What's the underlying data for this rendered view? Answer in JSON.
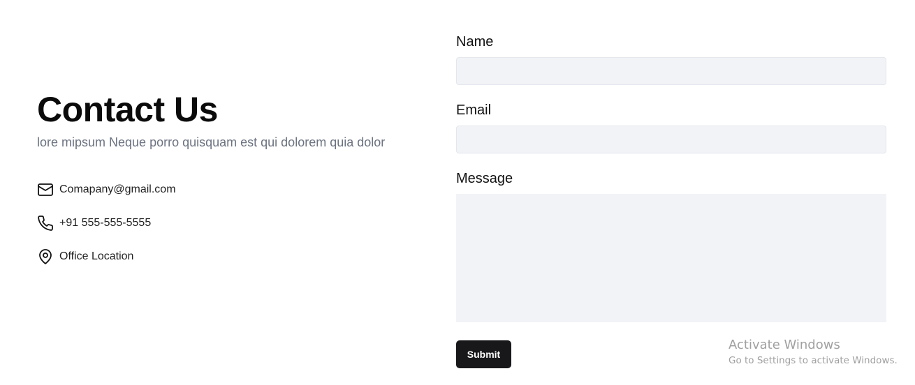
{
  "contact": {
    "title": "Contact Us",
    "subtitle": "lore mipsum Neque porro quisquam est qui dolorem quia dolor",
    "items": [
      {
        "icon": "mail-icon",
        "text": "Comapany@gmail.com"
      },
      {
        "icon": "phone-icon",
        "text": "+91 555-555-5555"
      },
      {
        "icon": "location-pin-icon",
        "text": "Office Location"
      }
    ]
  },
  "form": {
    "name_label": "Name",
    "name_value": "",
    "email_label": "Email",
    "email_value": "",
    "message_label": "Message",
    "message_value": "",
    "submit_label": "Submit"
  },
  "watermark": {
    "title": "Activate Windows",
    "subtitle": "Go to Settings to activate Windows."
  },
  "colors": {
    "input_bg": "#f1f3f7",
    "button_bg": "#18181b",
    "subtitle": "#6b7280"
  }
}
